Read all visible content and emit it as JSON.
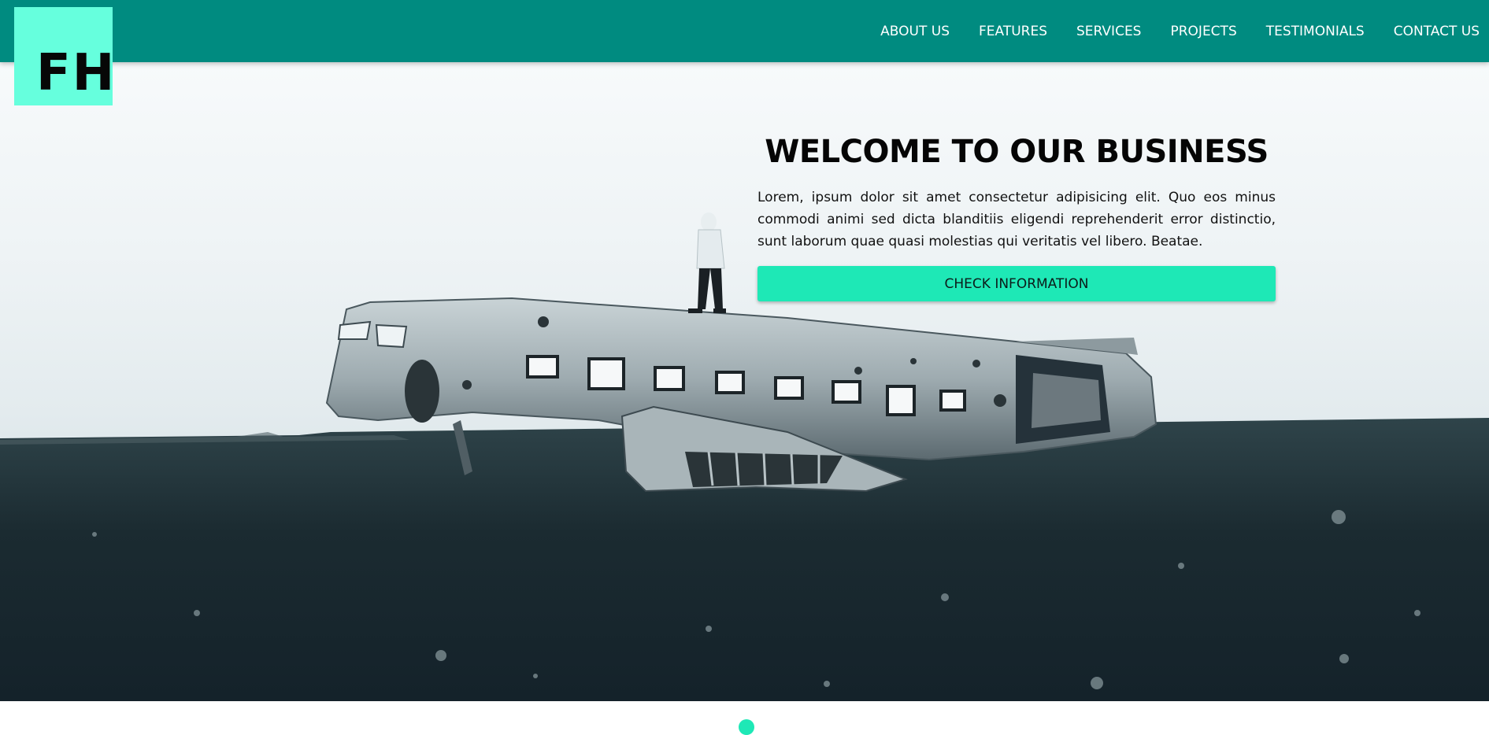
{
  "logo": {
    "text": "FH"
  },
  "nav": {
    "items": [
      {
        "label": "ABOUT US"
      },
      {
        "label": "FEATURES"
      },
      {
        "label": "SERVICES"
      },
      {
        "label": "PROJECTS"
      },
      {
        "label": "TESTIMONIALS"
      },
      {
        "label": "CONTACT US"
      }
    ]
  },
  "hero": {
    "title": "WELCOME TO OUR BUSINESS",
    "text": "Lorem, ipsum dolor sit amet consectetur adipisicing elit. Quo eos minus commodi animi sed dicta blanditiis eligendi reprehenderit error distinctio, sunt laborum quae quasi molestias qui veritatis vel libero. Beatae.",
    "button_label": "CHECK INFORMATION"
  },
  "colors": {
    "header_bg": "#008b80",
    "logo_bg": "#66ffdd",
    "button_bg": "#1ee8b6"
  }
}
